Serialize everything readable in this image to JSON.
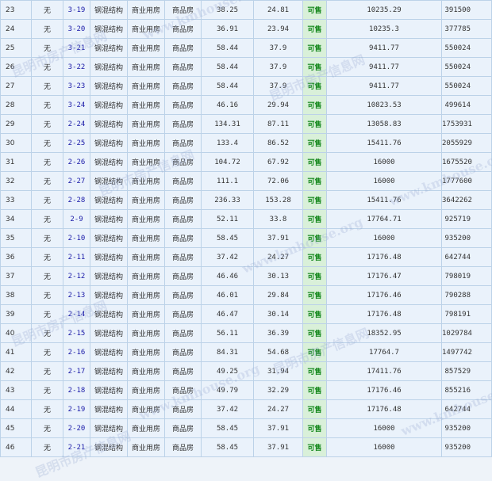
{
  "rows": [
    {
      "n": "23",
      "no": "无",
      "room": "3-19",
      "struct": "钢混结构",
      "use": "商业用房",
      "kind": "商品房",
      "a1": "38.25",
      "a2": "24.81",
      "status": "可售",
      "price": "10235.29",
      "total": "391500"
    },
    {
      "n": "24",
      "no": "无",
      "room": "3-20",
      "struct": "钢混结构",
      "use": "商业用房",
      "kind": "商品房",
      "a1": "36.91",
      "a2": "23.94",
      "status": "可售",
      "price": "10235.3",
      "total": "377785"
    },
    {
      "n": "25",
      "no": "无",
      "room": "3-21",
      "struct": "钢混结构",
      "use": "商业用房",
      "kind": "商品房",
      "a1": "58.44",
      "a2": "37.9",
      "status": "可售",
      "price": "9411.77",
      "total": "550024"
    },
    {
      "n": "26",
      "no": "无",
      "room": "3-22",
      "struct": "钢混结构",
      "use": "商业用房",
      "kind": "商品房",
      "a1": "58.44",
      "a2": "37.9",
      "status": "可售",
      "price": "9411.77",
      "total": "550024"
    },
    {
      "n": "27",
      "no": "无",
      "room": "3-23",
      "struct": "钢混结构",
      "use": "商业用房",
      "kind": "商品房",
      "a1": "58.44",
      "a2": "37.9",
      "status": "可售",
      "price": "9411.77",
      "total": "550024"
    },
    {
      "n": "28",
      "no": "无",
      "room": "3-24",
      "struct": "钢混结构",
      "use": "商业用房",
      "kind": "商品房",
      "a1": "46.16",
      "a2": "29.94",
      "status": "可售",
      "price": "10823.53",
      "total": "499614"
    },
    {
      "n": "29",
      "no": "无",
      "room": "2-24",
      "struct": "钢混结构",
      "use": "商业用房",
      "kind": "商品房",
      "a1": "134.31",
      "a2": "87.11",
      "status": "可售",
      "price": "13058.83",
      "total": "1753931"
    },
    {
      "n": "30",
      "no": "无",
      "room": "2-25",
      "struct": "钢混结构",
      "use": "商业用房",
      "kind": "商品房",
      "a1": "133.4",
      "a2": "86.52",
      "status": "可售",
      "price": "15411.76",
      "total": "2055929"
    },
    {
      "n": "31",
      "no": "无",
      "room": "2-26",
      "struct": "钢混结构",
      "use": "商业用房",
      "kind": "商品房",
      "a1": "104.72",
      "a2": "67.92",
      "status": "可售",
      "price": "16000",
      "total": "1675520"
    },
    {
      "n": "32",
      "no": "无",
      "room": "2-27",
      "struct": "钢混结构",
      "use": "商业用房",
      "kind": "商品房",
      "a1": "111.1",
      "a2": "72.06",
      "status": "可售",
      "price": "16000",
      "total": "1777600"
    },
    {
      "n": "33",
      "no": "无",
      "room": "2-28",
      "struct": "钢混结构",
      "use": "商业用房",
      "kind": "商品房",
      "a1": "236.33",
      "a2": "153.28",
      "status": "可售",
      "price": "15411.76",
      "total": "3642262"
    },
    {
      "n": "34",
      "no": "无",
      "room": "2-9",
      "struct": "钢混结构",
      "use": "商业用房",
      "kind": "商品房",
      "a1": "52.11",
      "a2": "33.8",
      "status": "可售",
      "price": "17764.71",
      "total": "925719"
    },
    {
      "n": "35",
      "no": "无",
      "room": "2-10",
      "struct": "钢混结构",
      "use": "商业用房",
      "kind": "商品房",
      "a1": "58.45",
      "a2": "37.91",
      "status": "可售",
      "price": "16000",
      "total": "935200"
    },
    {
      "n": "36",
      "no": "无",
      "room": "2-11",
      "struct": "钢混结构",
      "use": "商业用房",
      "kind": "商品房",
      "a1": "37.42",
      "a2": "24.27",
      "status": "可售",
      "price": "17176.48",
      "total": "642744"
    },
    {
      "n": "37",
      "no": "无",
      "room": "2-12",
      "struct": "钢混结构",
      "use": "商业用房",
      "kind": "商品房",
      "a1": "46.46",
      "a2": "30.13",
      "status": "可售",
      "price": "17176.47",
      "total": "798019"
    },
    {
      "n": "38",
      "no": "无",
      "room": "2-13",
      "struct": "钢混结构",
      "use": "商业用房",
      "kind": "商品房",
      "a1": "46.01",
      "a2": "29.84",
      "status": "可售",
      "price": "17176.46",
      "total": "790288"
    },
    {
      "n": "39",
      "no": "无",
      "room": "2-14",
      "struct": "钢混结构",
      "use": "商业用房",
      "kind": "商品房",
      "a1": "46.47",
      "a2": "30.14",
      "status": "可售",
      "price": "17176.48",
      "total": "798191"
    },
    {
      "n": "40",
      "no": "无",
      "room": "2-15",
      "struct": "钢混结构",
      "use": "商业用房",
      "kind": "商品房",
      "a1": "56.11",
      "a2": "36.39",
      "status": "可售",
      "price": "18352.95",
      "total": "1029784"
    },
    {
      "n": "41",
      "no": "无",
      "room": "2-16",
      "struct": "钢混结构",
      "use": "商业用房",
      "kind": "商品房",
      "a1": "84.31",
      "a2": "54.68",
      "status": "可售",
      "price": "17764.7",
      "total": "1497742"
    },
    {
      "n": "42",
      "no": "无",
      "room": "2-17",
      "struct": "钢混结构",
      "use": "商业用房",
      "kind": "商品房",
      "a1": "49.25",
      "a2": "31.94",
      "status": "可售",
      "price": "17411.76",
      "total": "857529"
    },
    {
      "n": "43",
      "no": "无",
      "room": "2-18",
      "struct": "钢混结构",
      "use": "商业用房",
      "kind": "商品房",
      "a1": "49.79",
      "a2": "32.29",
      "status": "可售",
      "price": "17176.46",
      "total": "855216"
    },
    {
      "n": "44",
      "no": "无",
      "room": "2-19",
      "struct": "钢混结构",
      "use": "商业用房",
      "kind": "商品房",
      "a1": "37.42",
      "a2": "24.27",
      "status": "可售",
      "price": "17176.48",
      "total": "642744"
    },
    {
      "n": "45",
      "no": "无",
      "room": "2-20",
      "struct": "钢混结构",
      "use": "商业用房",
      "kind": "商品房",
      "a1": "58.45",
      "a2": "37.91",
      "status": "可售",
      "price": "16000",
      "total": "935200"
    },
    {
      "n": "46",
      "no": "无",
      "room": "2-21",
      "struct": "钢混结构",
      "use": "商业用房",
      "kind": "商品房",
      "a1": "58.45",
      "a2": "37.91",
      "status": "可售",
      "price": "16000",
      "total": "935200"
    }
  ],
  "watermark": {
    "site_name": "昆明市房产信息网",
    "domain": "www.kmhouse.org"
  }
}
